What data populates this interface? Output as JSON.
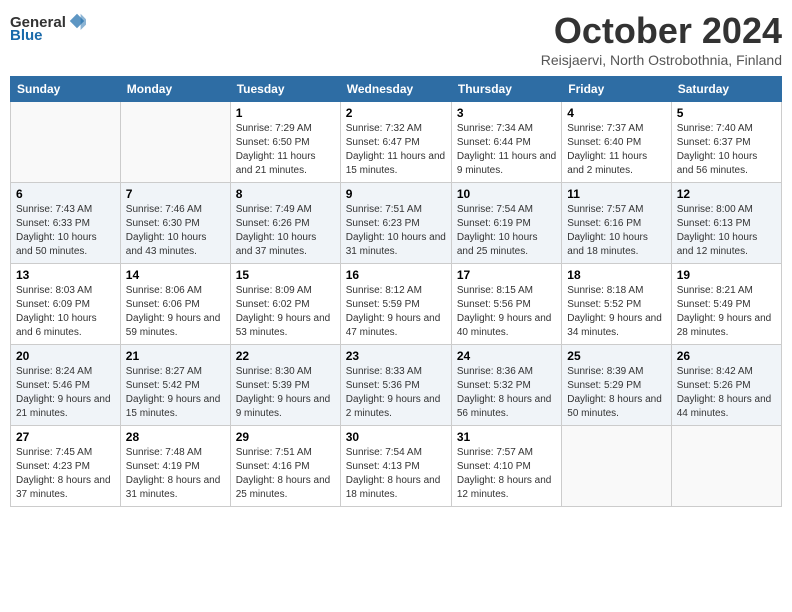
{
  "header": {
    "logo_general": "General",
    "logo_blue": "Blue",
    "title": "October 2024",
    "subtitle": "Reisjaervi, North Ostrobothnia, Finland"
  },
  "days_of_week": [
    "Sunday",
    "Monday",
    "Tuesday",
    "Wednesday",
    "Thursday",
    "Friday",
    "Saturday"
  ],
  "weeks": [
    [
      {
        "day": "",
        "info": ""
      },
      {
        "day": "",
        "info": ""
      },
      {
        "day": "1",
        "info": "Sunrise: 7:29 AM\nSunset: 6:50 PM\nDaylight: 11 hours and 21 minutes."
      },
      {
        "day": "2",
        "info": "Sunrise: 7:32 AM\nSunset: 6:47 PM\nDaylight: 11 hours and 15 minutes."
      },
      {
        "day": "3",
        "info": "Sunrise: 7:34 AM\nSunset: 6:44 PM\nDaylight: 11 hours and 9 minutes."
      },
      {
        "day": "4",
        "info": "Sunrise: 7:37 AM\nSunset: 6:40 PM\nDaylight: 11 hours and 2 minutes."
      },
      {
        "day": "5",
        "info": "Sunrise: 7:40 AM\nSunset: 6:37 PM\nDaylight: 10 hours and 56 minutes."
      }
    ],
    [
      {
        "day": "6",
        "info": "Sunrise: 7:43 AM\nSunset: 6:33 PM\nDaylight: 10 hours and 50 minutes."
      },
      {
        "day": "7",
        "info": "Sunrise: 7:46 AM\nSunset: 6:30 PM\nDaylight: 10 hours and 43 minutes."
      },
      {
        "day": "8",
        "info": "Sunrise: 7:49 AM\nSunset: 6:26 PM\nDaylight: 10 hours and 37 minutes."
      },
      {
        "day": "9",
        "info": "Sunrise: 7:51 AM\nSunset: 6:23 PM\nDaylight: 10 hours and 31 minutes."
      },
      {
        "day": "10",
        "info": "Sunrise: 7:54 AM\nSunset: 6:19 PM\nDaylight: 10 hours and 25 minutes."
      },
      {
        "day": "11",
        "info": "Sunrise: 7:57 AM\nSunset: 6:16 PM\nDaylight: 10 hours and 18 minutes."
      },
      {
        "day": "12",
        "info": "Sunrise: 8:00 AM\nSunset: 6:13 PM\nDaylight: 10 hours and 12 minutes."
      }
    ],
    [
      {
        "day": "13",
        "info": "Sunrise: 8:03 AM\nSunset: 6:09 PM\nDaylight: 10 hours and 6 minutes."
      },
      {
        "day": "14",
        "info": "Sunrise: 8:06 AM\nSunset: 6:06 PM\nDaylight: 9 hours and 59 minutes."
      },
      {
        "day": "15",
        "info": "Sunrise: 8:09 AM\nSunset: 6:02 PM\nDaylight: 9 hours and 53 minutes."
      },
      {
        "day": "16",
        "info": "Sunrise: 8:12 AM\nSunset: 5:59 PM\nDaylight: 9 hours and 47 minutes."
      },
      {
        "day": "17",
        "info": "Sunrise: 8:15 AM\nSunset: 5:56 PM\nDaylight: 9 hours and 40 minutes."
      },
      {
        "day": "18",
        "info": "Sunrise: 8:18 AM\nSunset: 5:52 PM\nDaylight: 9 hours and 34 minutes."
      },
      {
        "day": "19",
        "info": "Sunrise: 8:21 AM\nSunset: 5:49 PM\nDaylight: 9 hours and 28 minutes."
      }
    ],
    [
      {
        "day": "20",
        "info": "Sunrise: 8:24 AM\nSunset: 5:46 PM\nDaylight: 9 hours and 21 minutes."
      },
      {
        "day": "21",
        "info": "Sunrise: 8:27 AM\nSunset: 5:42 PM\nDaylight: 9 hours and 15 minutes."
      },
      {
        "day": "22",
        "info": "Sunrise: 8:30 AM\nSunset: 5:39 PM\nDaylight: 9 hours and 9 minutes."
      },
      {
        "day": "23",
        "info": "Sunrise: 8:33 AM\nSunset: 5:36 PM\nDaylight: 9 hours and 2 minutes."
      },
      {
        "day": "24",
        "info": "Sunrise: 8:36 AM\nSunset: 5:32 PM\nDaylight: 8 hours and 56 minutes."
      },
      {
        "day": "25",
        "info": "Sunrise: 8:39 AM\nSunset: 5:29 PM\nDaylight: 8 hours and 50 minutes."
      },
      {
        "day": "26",
        "info": "Sunrise: 8:42 AM\nSunset: 5:26 PM\nDaylight: 8 hours and 44 minutes."
      }
    ],
    [
      {
        "day": "27",
        "info": "Sunrise: 7:45 AM\nSunset: 4:23 PM\nDaylight: 8 hours and 37 minutes."
      },
      {
        "day": "28",
        "info": "Sunrise: 7:48 AM\nSunset: 4:19 PM\nDaylight: 8 hours and 31 minutes."
      },
      {
        "day": "29",
        "info": "Sunrise: 7:51 AM\nSunset: 4:16 PM\nDaylight: 8 hours and 25 minutes."
      },
      {
        "day": "30",
        "info": "Sunrise: 7:54 AM\nSunset: 4:13 PM\nDaylight: 8 hours and 18 minutes."
      },
      {
        "day": "31",
        "info": "Sunrise: 7:57 AM\nSunset: 4:10 PM\nDaylight: 8 hours and 12 minutes."
      },
      {
        "day": "",
        "info": ""
      },
      {
        "day": "",
        "info": ""
      }
    ]
  ]
}
